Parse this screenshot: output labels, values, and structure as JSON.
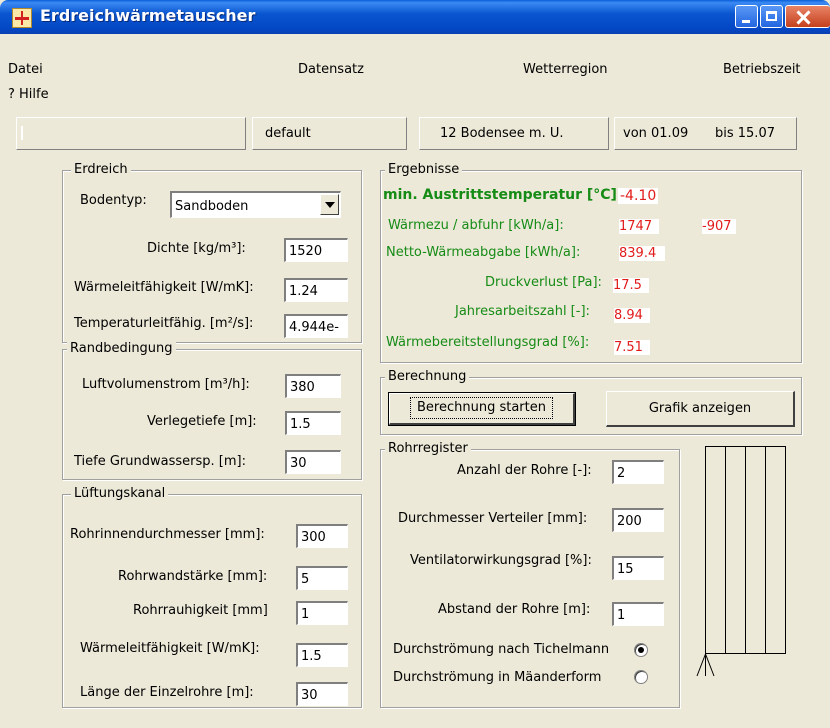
{
  "window": {
    "title": "Erdreichwärmetauscher"
  },
  "menu": {
    "datei": "Datei",
    "datensatz": "Datensatz",
    "wetterregion": "Wetterregion",
    "betriebszeit": "Betriebszeit",
    "hilfe": "? Hilfe"
  },
  "status": {
    "datensatz": "default",
    "wetterregion": "12 Bodensee m. U.",
    "von": "von 01.09",
    "bis": "bis 15.07"
  },
  "erdreich": {
    "title": "Erdreich",
    "bodentyp_label": "Bodentyp:",
    "bodentyp_value": "Sandboden",
    "dichte_label": "Dichte [kg/m³]:",
    "dichte_value": "1520",
    "waermeleit_label": "Wärmeleitfähigkeit [W/mK]:",
    "waermeleit_value": "1.24",
    "temperaturleit_label": "Temperaturleitfähig. [m²/s]:",
    "temperaturleit_value": "4.944e-"
  },
  "randbedingung": {
    "title": "Randbedingung",
    "luftvolumen_label": "Luftvolumenstrom [m³/h]:",
    "luftvolumen_value": "380",
    "verlegetiefe_label": "Verlegetiefe [m]:",
    "verlegetiefe_value": "1.5",
    "grundwasser_label": "Tiefe Grundwassersp. [m]:",
    "grundwasser_value": "30"
  },
  "lueftungskanal": {
    "title": "Lüftungskanal",
    "innendurchmesser_label": "Rohrinnendurchmesser [mm]:",
    "innendurchmesser_value": "300",
    "wandstaerke_label": "Rohrwandstärke [mm]:",
    "wandstaerke_value": "5",
    "rauhigkeit_label": "Rohrrauhigkeit [mm]",
    "rauhigkeit_value": "1",
    "waermeleit_label": "Wärmeleitfähigkeit  [W/mK]:",
    "waermeleit_value": "1.5",
    "laenge_label": "Länge der  Einzelrohre [m]:",
    "laenge_value": "30"
  },
  "ergebnisse": {
    "title": "Ergebnisse",
    "min_temp_label": "min. Austrittstemperatur [°C]:",
    "min_temp_value": "-4.10",
    "waermezu_label": "Wärmezu / abfuhr [kWh/a]:",
    "waermezu_value": "1747",
    "waermeab_value": "-907",
    "netto_label": "Netto-Wärmeabgabe [kWh/a]:",
    "netto_value": "839.4",
    "druckverlust_label": "Druckverlust [Pa]:",
    "druckverlust_value": "17.5",
    "jaz_label": "Jahresarbeitszahl [-]:",
    "jaz_value": "8.94",
    "bereitstellung_label": "Wärmebereitstellungsgrad [%]:",
    "bereitstellung_value": "7.51"
  },
  "berechnung": {
    "title": "Berechnung",
    "start_label": "Berechnung starten",
    "grafik_label": "Grafik anzeigen"
  },
  "rohrregister": {
    "title": "Rohrregister",
    "anzahl_label": "Anzahl der Rohre [-]:",
    "anzahl_value": "2",
    "verteiler_label": "Durchmesser Verteiler [mm]:",
    "verteiler_value": "200",
    "ventilator_label": "Ventilatorwirkungsgrad [%]:",
    "ventilator_value": "15",
    "abstand_label": "Abstand der Rohre [m]:",
    "abstand_value": "1",
    "tichelmann_label": "Durchströmung nach Tichelmann",
    "tichelmann_selected": true,
    "maeander_label": "Durchströmung in Mäanderform",
    "maeander_selected": false
  }
}
